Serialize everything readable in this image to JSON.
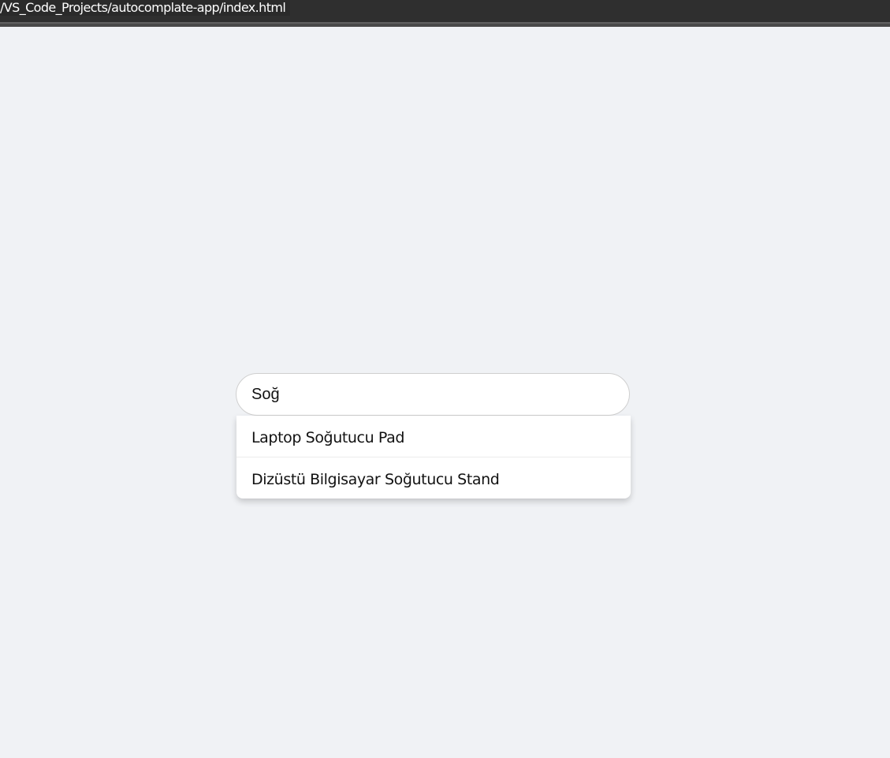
{
  "browser": {
    "address_text": "/VS_Code_Projects/autocomplate-app/index.html"
  },
  "search": {
    "value": "Soğ"
  },
  "suggestions": [
    {
      "label": "Laptop Soğutucu Pad"
    },
    {
      "label": "Dizüstü Bilgisayar Soğutucu Stand"
    }
  ]
}
